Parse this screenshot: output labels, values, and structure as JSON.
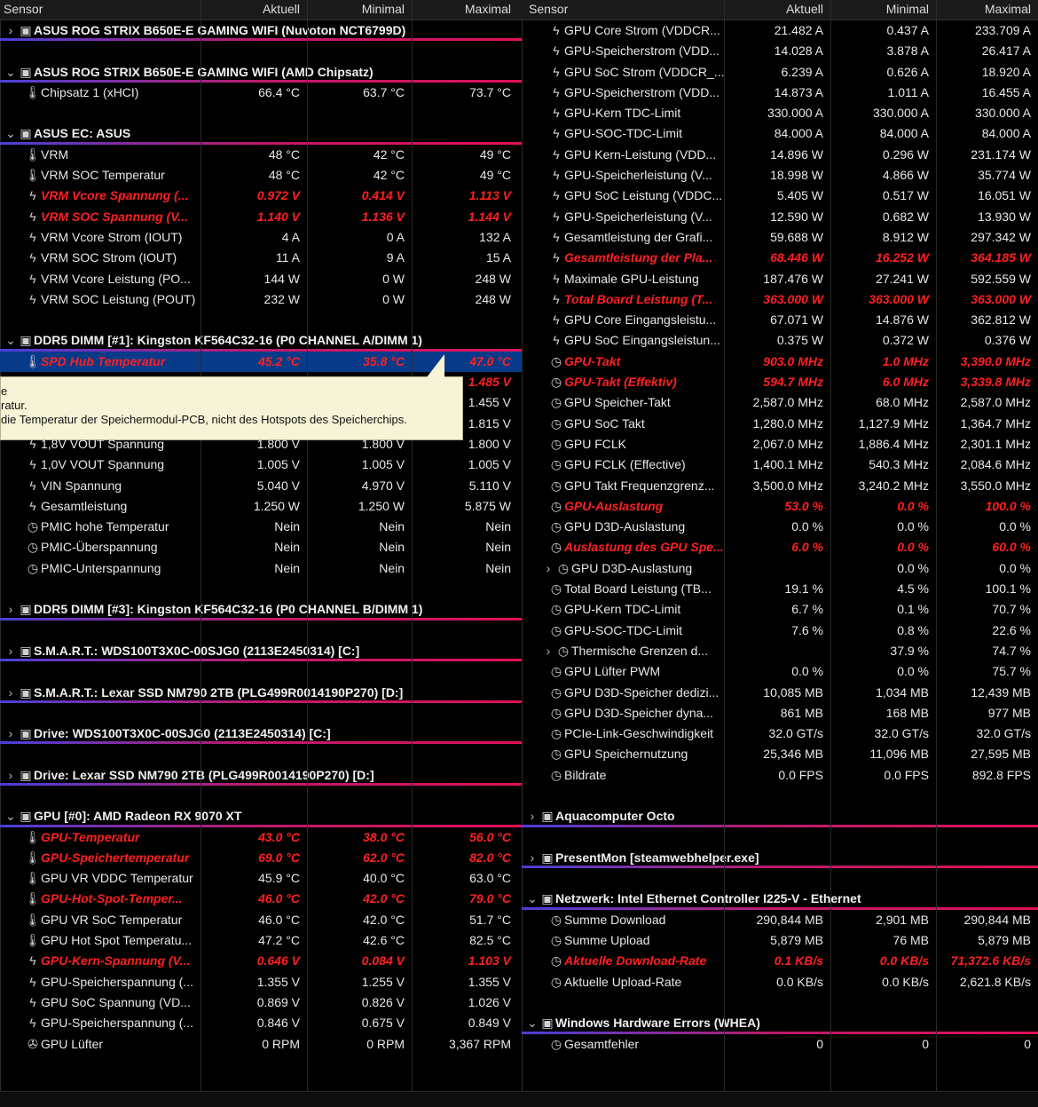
{
  "headers": [
    "Sensor",
    "Aktuell",
    "Minimal",
    "Maximal"
  ],
  "colors": {
    "background": "#000000",
    "alarm": "#ff2020",
    "group_underline": "#c01a6a",
    "selected_row": "#083a8a",
    "tooltip_bg": "#f7f3d6"
  },
  "left": [
    {
      "t": "group",
      "expander": "›",
      "icon": "chip-icon",
      "label": "ASUS ROG STRIX B650E-E GAMING WIFI (Nuvoton NCT6799D)",
      "vals": [
        "",
        "",
        ""
      ]
    },
    {
      "t": "blank"
    },
    {
      "t": "group",
      "expander": "⌄",
      "icon": "chip-icon",
      "label": "ASUS ROG STRIX B650E-E GAMING WIFI (AMD Chipsatz)",
      "vals": [
        "",
        "",
        ""
      ]
    },
    {
      "t": "row",
      "icon": "thermometer-icon",
      "label": "Chipsatz 1 (xHCI)",
      "vals": [
        "66.4 °C",
        "63.7 °C",
        "73.7 °C"
      ]
    },
    {
      "t": "blank"
    },
    {
      "t": "group",
      "expander": "⌄",
      "icon": "chip-icon",
      "label": "ASUS EC: ASUS",
      "vals": [
        "",
        "",
        ""
      ]
    },
    {
      "t": "row",
      "icon": "thermometer-icon",
      "label": "VRM",
      "vals": [
        "48 °C",
        "42 °C",
        "49 °C"
      ]
    },
    {
      "t": "row",
      "icon": "thermometer-icon",
      "label": "VRM SOC Temperatur",
      "vals": [
        "48 °C",
        "42 °C",
        "49 °C"
      ]
    },
    {
      "t": "alarm",
      "icon": "lightning-icon",
      "label": "VRM Vcore Spannung (...",
      "vals": [
        "0.972 V",
        "0.414 V",
        "1.113 V"
      ]
    },
    {
      "t": "alarm",
      "icon": "lightning-icon",
      "label": "VRM SOC Spannung (V...",
      "vals": [
        "1.140 V",
        "1.136 V",
        "1.144 V"
      ]
    },
    {
      "t": "row",
      "icon": "lightning-icon",
      "label": "VRM Vcore Strom (IOUT)",
      "vals": [
        "4 A",
        "0 A",
        "132 A"
      ]
    },
    {
      "t": "row",
      "icon": "lightning-icon",
      "label": "VRM SOC Strom (IOUT)",
      "vals": [
        "11 A",
        "9 A",
        "15 A"
      ]
    },
    {
      "t": "row",
      "icon": "lightning-icon",
      "label": "VRM Vcore Leistung (PO...",
      "vals": [
        "144 W",
        "0 W",
        "248 W"
      ]
    },
    {
      "t": "row",
      "icon": "lightning-icon",
      "label": "VRM SOC Leistung (POUT)",
      "vals": [
        "232 W",
        "0 W",
        "248 W"
      ]
    },
    {
      "t": "blank"
    },
    {
      "t": "group",
      "expander": "⌄",
      "icon": "chip-icon",
      "label": "DDR5 DIMM [#1]: Kingston KF564C32-16 (P0 CHANNEL A/DIMM 1)",
      "vals": [
        "",
        "",
        ""
      ]
    },
    {
      "t": "alarm",
      "sel": true,
      "icon": "thermometer-icon",
      "label": "SPD Hub Temperatur",
      "vals": [
        "45.2 °C",
        "35.8 °C",
        "47.0 °C"
      ]
    },
    {
      "t": "alarm",
      "icon": "lightning-icon",
      "label": "",
      "vals": [
        "",
        "",
        "1.485 V"
      ]
    },
    {
      "t": "row",
      "icon": "lightning-icon",
      "label": "",
      "vals": [
        "",
        "",
        "1.455 V"
      ]
    },
    {
      "t": "row",
      "icon": "lightning-icon",
      "label": "",
      "vals": [
        "",
        "",
        "1.815 V"
      ]
    },
    {
      "t": "row",
      "icon": "lightning-icon",
      "label": "1,8V VOUT Spannung",
      "vals": [
        "1.800 V",
        "1.800 V",
        "1.800 V"
      ]
    },
    {
      "t": "row",
      "icon": "lightning-icon",
      "label": "1,0V VOUT Spannung",
      "vals": [
        "1.005 V",
        "1.005 V",
        "1.005 V"
      ]
    },
    {
      "t": "row",
      "icon": "lightning-icon",
      "label": "VIN Spannung",
      "vals": [
        "5.040 V",
        "4.970 V",
        "5.110 V"
      ]
    },
    {
      "t": "row",
      "icon": "lightning-icon",
      "label": "Gesamtleistung",
      "vals": [
        "1.250 W",
        "1.250 W",
        "5.875 W"
      ]
    },
    {
      "t": "row",
      "icon": "clock-icon",
      "label": "PMIC hohe Temperatur",
      "vals": [
        "Nein",
        "Nein",
        "Nein"
      ]
    },
    {
      "t": "row",
      "icon": "clock-icon",
      "label": "PMIC-Überspannung",
      "vals": [
        "Nein",
        "Nein",
        "Nein"
      ]
    },
    {
      "t": "row",
      "icon": "clock-icon",
      "label": "PMIC-Unterspannung",
      "vals": [
        "Nein",
        "Nein",
        "Nein"
      ]
    },
    {
      "t": "blank"
    },
    {
      "t": "group",
      "expander": "›",
      "icon": "chip-icon",
      "label": "DDR5 DIMM [#3]: Kingston KF564C32-16 (P0 CHANNEL B/DIMM 1)",
      "vals": [
        "",
        "",
        ""
      ]
    },
    {
      "t": "blank"
    },
    {
      "t": "group",
      "expander": "›",
      "icon": "chip-icon",
      "label": "S.M.A.R.T.: WDS100T3X0C-00SJG0 (2113E2450314) [C:]",
      "vals": [
        "",
        "",
        ""
      ]
    },
    {
      "t": "blank"
    },
    {
      "t": "group",
      "expander": "›",
      "icon": "chip-icon",
      "label": "S.M.A.R.T.: Lexar SSD NM790 2TB (PLG499R0014190P270) [D:]",
      "vals": [
        "",
        "",
        ""
      ]
    },
    {
      "t": "blank"
    },
    {
      "t": "group",
      "expander": "›",
      "icon": "chip-icon",
      "label": "Drive: WDS100T3X0C-00SJG0 (2113E2450314) [C:]",
      "vals": [
        "",
        "",
        ""
      ]
    },
    {
      "t": "blank"
    },
    {
      "t": "group",
      "expander": "›",
      "icon": "chip-icon",
      "label": "Drive: Lexar SSD NM790 2TB (PLG499R0014190P270) [D:]",
      "vals": [
        "",
        "",
        ""
      ]
    },
    {
      "t": "blank"
    },
    {
      "t": "group",
      "expander": "⌄",
      "icon": "chip-icon",
      "label": "GPU [#0]: AMD Radeon RX 9070 XT",
      "vals": [
        "",
        "",
        ""
      ]
    },
    {
      "t": "alarm",
      "icon": "thermometer-icon",
      "label": "GPU-Temperatur",
      "vals": [
        "43.0 °C",
        "38.0 °C",
        "56.0 °C"
      ]
    },
    {
      "t": "alarm",
      "icon": "thermometer-icon",
      "label": "GPU-Speichertemperatur",
      "vals": [
        "69.0 °C",
        "62.0 °C",
        "82.0 °C"
      ]
    },
    {
      "t": "row",
      "icon": "thermometer-icon",
      "label": "GPU VR VDDC Temperatur",
      "vals": [
        "45.9 °C",
        "40.0 °C",
        "63.0 °C"
      ]
    },
    {
      "t": "alarm",
      "icon": "thermometer-icon",
      "label": "GPU-Hot-Spot-Temper...",
      "vals": [
        "46.0 °C",
        "42.0 °C",
        "79.0 °C"
      ]
    },
    {
      "t": "row",
      "icon": "thermometer-icon",
      "label": "GPU VR SoC Temperatur",
      "vals": [
        "46.0 °C",
        "42.0 °C",
        "51.7 °C"
      ]
    },
    {
      "t": "row",
      "icon": "thermometer-icon",
      "label": "GPU Hot Spot Temperatu...",
      "vals": [
        "47.2 °C",
        "42.6 °C",
        "82.5 °C"
      ]
    },
    {
      "t": "alarm",
      "icon": "lightning-icon",
      "label": "GPU-Kern-Spannung (V...",
      "vals": [
        "0.646 V",
        "0.084 V",
        "1.103 V"
      ]
    },
    {
      "t": "row",
      "icon": "lightning-icon",
      "label": "GPU-Speicherspannung (...",
      "vals": [
        "1.355 V",
        "1.255 V",
        "1.355 V"
      ]
    },
    {
      "t": "row",
      "icon": "lightning-icon",
      "label": "GPU SoC Spannung (VD...",
      "vals": [
        "0.869 V",
        "0.826 V",
        "1.026 V"
      ]
    },
    {
      "t": "row",
      "icon": "lightning-icon",
      "label": "GPU-Speicherspannung (...",
      "vals": [
        "0.846 V",
        "0.675 V",
        "0.849 V"
      ]
    },
    {
      "t": "row",
      "icon": "fan-icon",
      "label": "GPU Lüfter",
      "vals": [
        "0 RPM",
        "0 RPM",
        "3,367 RPM"
      ]
    }
  ],
  "right": [
    {
      "t": "row",
      "icon": "lightning-icon",
      "label": "GPU Core Strom (VDDCR...",
      "vals": [
        "21.482 A",
        "0.437 A",
        "233.709 A"
      ]
    },
    {
      "t": "row",
      "icon": "lightning-icon",
      "label": "GPU-Speicherstrom (VDD...",
      "vals": [
        "14.028 A",
        "3.878 A",
        "26.417 A"
      ]
    },
    {
      "t": "row",
      "icon": "lightning-icon",
      "label": "GPU SoC Strom (VDDCR_...",
      "vals": [
        "6.239 A",
        "0.626 A",
        "18.920 A"
      ]
    },
    {
      "t": "row",
      "icon": "lightning-icon",
      "label": "GPU-Speicherstrom (VDD...",
      "vals": [
        "14.873 A",
        "1.011 A",
        "16.455 A"
      ]
    },
    {
      "t": "row",
      "icon": "lightning-icon",
      "label": "GPU-Kern TDC-Limit",
      "vals": [
        "330.000 A",
        "330.000 A",
        "330.000 A"
      ]
    },
    {
      "t": "row",
      "icon": "lightning-icon",
      "label": "GPU-SOC-TDC-Limit",
      "vals": [
        "84.000 A",
        "84.000 A",
        "84.000 A"
      ]
    },
    {
      "t": "row",
      "icon": "lightning-icon",
      "label": "GPU Kern-Leistung (VDD...",
      "vals": [
        "14.896 W",
        "0.296 W",
        "231.174 W"
      ]
    },
    {
      "t": "row",
      "icon": "lightning-icon",
      "label": "GPU-Speicherleistung (V...",
      "vals": [
        "18.998 W",
        "4.866 W",
        "35.774 W"
      ]
    },
    {
      "t": "row",
      "icon": "lightning-icon",
      "label": "GPU SoC Leistung (VDDC...",
      "vals": [
        "5.405 W",
        "0.517 W",
        "16.051 W"
      ]
    },
    {
      "t": "row",
      "icon": "lightning-icon",
      "label": "GPU-Speicherleistung (V...",
      "vals": [
        "12.590 W",
        "0.682 W",
        "13.930 W"
      ]
    },
    {
      "t": "row",
      "icon": "lightning-icon",
      "label": "Gesamtleistung der Grafi...",
      "vals": [
        "59.688 W",
        "8.912 W",
        "297.342 W"
      ]
    },
    {
      "t": "alarm",
      "icon": "lightning-icon",
      "label": "Gesamtleistung der Pla...",
      "vals": [
        "68.446 W",
        "16.252 W",
        "364.185 W"
      ]
    },
    {
      "t": "row",
      "icon": "lightning-icon",
      "label": "Maximale GPU-Leistung",
      "vals": [
        "187.476 W",
        "27.241 W",
        "592.559 W"
      ]
    },
    {
      "t": "alarm",
      "icon": "lightning-icon",
      "label": "Total Board Leistung (T...",
      "vals": [
        "363.000 W",
        "363.000 W",
        "363.000 W"
      ]
    },
    {
      "t": "row",
      "icon": "lightning-icon",
      "label": "GPU Core Eingangsleistu...",
      "vals": [
        "67.071 W",
        "14.876 W",
        "362.812 W"
      ]
    },
    {
      "t": "row",
      "icon": "lightning-icon",
      "label": "GPU SoC Eingangsleistun...",
      "vals": [
        "0.375 W",
        "0.372 W",
        "0.376 W"
      ]
    },
    {
      "t": "alarm",
      "icon": "clock-icon",
      "label": "GPU-Takt",
      "vals": [
        "903.0 MHz",
        "1.0 MHz",
        "3,390.0 MHz"
      ]
    },
    {
      "t": "alarm",
      "icon": "clock-icon",
      "label": "GPU-Takt (Effektiv)",
      "vals": [
        "594.7 MHz",
        "6.0 MHz",
        "3,339.8 MHz"
      ]
    },
    {
      "t": "row",
      "icon": "clock-icon",
      "label": "GPU Speicher-Takt",
      "vals": [
        "2,587.0 MHz",
        "68.0 MHz",
        "2,587.0 MHz"
      ]
    },
    {
      "t": "row",
      "icon": "clock-icon",
      "label": "GPU SoC Takt",
      "vals": [
        "1,280.0 MHz",
        "1,127.9 MHz",
        "1,364.7 MHz"
      ]
    },
    {
      "t": "row",
      "icon": "clock-icon",
      "label": "GPU FCLK",
      "vals": [
        "2,067.0 MHz",
        "1,886.4 MHz",
        "2,301.1 MHz"
      ]
    },
    {
      "t": "row",
      "icon": "clock-icon",
      "label": "GPU FCLK (Effective)",
      "vals": [
        "1,400.1 MHz",
        "540.3 MHz",
        "2,084.6 MHz"
      ]
    },
    {
      "t": "row",
      "icon": "clock-icon",
      "label": "GPU Takt Frequenzgrenz...",
      "vals": [
        "3,500.0 MHz",
        "3,240.2 MHz",
        "3,550.0 MHz"
      ]
    },
    {
      "t": "alarm",
      "icon": "clock-icon",
      "label": "GPU-Auslastung",
      "vals": [
        "53.0 %",
        "0.0 %",
        "100.0 %"
      ]
    },
    {
      "t": "row",
      "icon": "clock-icon",
      "label": "GPU D3D-Auslastung",
      "vals": [
        "0.0 %",
        "0.0 %",
        "0.0 %"
      ]
    },
    {
      "t": "alarm",
      "icon": "clock-icon",
      "label": "Auslastung des GPU Spe...",
      "vals": [
        "6.0 %",
        "0.0 %",
        "60.0 %"
      ]
    },
    {
      "t": "row",
      "expander": "›",
      "icon": "clock-icon",
      "label": "GPU D3D-Auslastung",
      "vals": [
        "",
        "0.0 %",
        "0.0 %"
      ]
    },
    {
      "t": "row",
      "icon": "clock-icon",
      "label": "Total Board Leistung (TB...",
      "vals": [
        "19.1 %",
        "4.5 %",
        "100.1 %"
      ]
    },
    {
      "t": "row",
      "icon": "clock-icon",
      "label": "GPU-Kern TDC-Limit",
      "vals": [
        "6.7 %",
        "0.1 %",
        "70.7 %"
      ]
    },
    {
      "t": "row",
      "icon": "clock-icon",
      "label": "GPU-SOC-TDC-Limit",
      "vals": [
        "7.6 %",
        "0.8 %",
        "22.6 %"
      ]
    },
    {
      "t": "row",
      "expander": "›",
      "icon": "clock-icon",
      "label": "Thermische Grenzen d...",
      "vals": [
        "",
        "37.9 %",
        "74.7 %"
      ]
    },
    {
      "t": "row",
      "icon": "clock-icon",
      "label": "GPU Lüfter PWM",
      "vals": [
        "0.0 %",
        "0.0 %",
        "75.7 %"
      ]
    },
    {
      "t": "row",
      "icon": "clock-icon",
      "label": "GPU D3D-Speicher dedizi...",
      "vals": [
        "10,085 MB",
        "1,034 MB",
        "12,439 MB"
      ]
    },
    {
      "t": "row",
      "icon": "clock-icon",
      "label": "GPU D3D-Speicher dyna...",
      "vals": [
        "861 MB",
        "168 MB",
        "977 MB"
      ]
    },
    {
      "t": "row",
      "icon": "clock-icon",
      "label": "PCIe-Link-Geschwindigkeit",
      "vals": [
        "32.0 GT/s",
        "32.0 GT/s",
        "32.0 GT/s"
      ]
    },
    {
      "t": "row",
      "icon": "clock-icon",
      "label": "GPU Speichernutzung",
      "vals": [
        "25,346 MB",
        "11,096 MB",
        "27,595 MB"
      ]
    },
    {
      "t": "row",
      "icon": "clock-icon",
      "label": "Bildrate",
      "vals": [
        "0.0 FPS",
        "0.0 FPS",
        "892.8 FPS"
      ]
    },
    {
      "t": "blank"
    },
    {
      "t": "group",
      "expander": "›",
      "icon": "chip-icon",
      "label": "Aquacomputer Octo",
      "vals": [
        "",
        "",
        ""
      ]
    },
    {
      "t": "blank"
    },
    {
      "t": "group",
      "expander": "›",
      "icon": "chip-icon",
      "label": "PresentMon [steamwebhelper.exe]",
      "vals": [
        "",
        "",
        ""
      ]
    },
    {
      "t": "blank"
    },
    {
      "t": "group",
      "expander": "⌄",
      "icon": "chip-icon",
      "label": "Netzwerk: Intel Ethernet Controller I225-V - Ethernet",
      "vals": [
        "",
        "",
        ""
      ]
    },
    {
      "t": "row",
      "icon": "clock-icon",
      "label": "Summe Download",
      "vals": [
        "290,844 MB",
        "2,901 MB",
        "290,844 MB"
      ]
    },
    {
      "t": "row",
      "icon": "clock-icon",
      "label": "Summe Upload",
      "vals": [
        "5,879 MB",
        "76 MB",
        "5,879 MB"
      ]
    },
    {
      "t": "alarm",
      "icon": "clock-icon",
      "label": "Aktuelle Download-Rate",
      "vals": [
        "0.1 KB/s",
        "0.0 KB/s",
        "71,372.6 KB/s"
      ]
    },
    {
      "t": "row",
      "icon": "clock-icon",
      "label": "Aktuelle Upload-Rate",
      "vals": [
        "0.0 KB/s",
        "0.0 KB/s",
        "2,621.8 KB/s"
      ]
    },
    {
      "t": "blank"
    },
    {
      "t": "group",
      "expander": "⌄",
      "icon": "chip-icon",
      "label": "Windows Hardware Errors (WHEA)",
      "vals": [
        "",
        "",
        ""
      ]
    },
    {
      "t": "row",
      "icon": "clock-icon",
      "label": "Gesamtfehler",
      "vals": [
        "0",
        "0",
        "0"
      ]
    }
  ],
  "tooltip": {
    "lines": [
      "e",
      "ratur.",
      "die Temperatur der Speichermodul-PCB, nicht des Hotspots des Speicherchips."
    ]
  }
}
